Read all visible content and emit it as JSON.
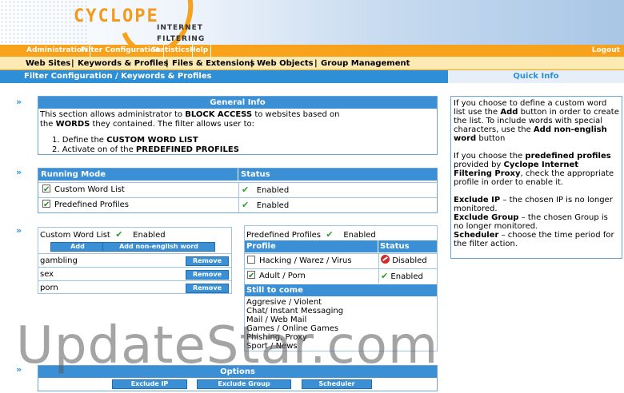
{
  "header": {
    "logo": "CYCLOPE",
    "logo_sub1": "INTERNET",
    "logo_sub2": "FILTERING"
  },
  "topnav": {
    "items": [
      "Administration",
      "Filter Configuration",
      "Statistics",
      "Help"
    ],
    "logout": "Logout"
  },
  "subnav": {
    "items": [
      "Web Sites",
      "Keywords & Profiles",
      "Files & Extensions",
      "Web Objects",
      "Group Management"
    ]
  },
  "breadcrumb": "Filter Configuration / Keywords & Profiles",
  "quick_info_title": "Quick Info",
  "general": {
    "title": "General Info",
    "p1a": "This section allows administrator to ",
    "p1b": "BLOCK ACCESS",
    "p1c": " to websites based on",
    "p2a": "the ",
    "p2b": "WORDS",
    "p2c": " they contained. The filter allows user to:",
    "l1a": "1. Define the ",
    "l1b": "CUSTOM WORD LIST",
    "l2a": "2. Activate on of the ",
    "l2b": "PREDEFINED PROFILES"
  },
  "running": {
    "col1": "Running Mode",
    "col2": "Status",
    "rows": [
      {
        "label": "Custom Word List",
        "status": "Enabled"
      },
      {
        "label": "Predefined Profiles",
        "status": "Enabled"
      }
    ]
  },
  "custom": {
    "title": "Custom Word List",
    "status": "Enabled",
    "add": "Add",
    "add_non_english": "Add non-english word",
    "words": [
      "gambling",
      "sex",
      "porn"
    ],
    "remove": "Remove"
  },
  "predef": {
    "title": "Predefined Profiles",
    "status": "Enabled",
    "col1": "Profile",
    "col2": "Status",
    "rows": [
      {
        "label": "Hacking / Warez / Virus",
        "status": "Disabled"
      },
      {
        "label": "Adult / Porn",
        "status": "Enabled"
      }
    ],
    "still_title": "Still to come",
    "still": [
      "Aggresive / Violent",
      "Chat/ Instant Messaging",
      "Mail / Web Mail",
      "Games / Online Games",
      "Phishing, Proxy",
      "Sport / News"
    ]
  },
  "options": {
    "title": "Options",
    "b1": "Exclude IP",
    "b2": "Exclude Group",
    "b3": "Scheduler"
  },
  "quick": {
    "q1a": "If you choose to define a custom word list use the ",
    "q1b": "Add",
    "q1c": " button in order to create the list. To include words with special characters, use the ",
    "q1d": "Add non-english word",
    "q1e": " button",
    "q2a": "If you choose the ",
    "q2b": "predefined profiles",
    "q2c": " provided by ",
    "q2d": "Cyclope Internet Filtering Proxy",
    "q2e": ", check the appropriate profile in order to enable it.",
    "q3a": "Exclude IP",
    "q3b": " – the chosen IP is no longer monitored.",
    "q4a": "Exclude Group",
    "q4b": " – the chosen Group is no longer monitored.",
    "q5a": "Scheduler",
    "q5b": " – choose the time period for the filter action."
  },
  "watermark": "UpdateStar.com",
  "raquo": "»"
}
